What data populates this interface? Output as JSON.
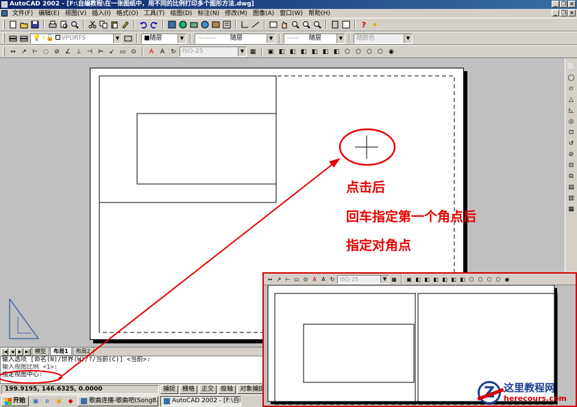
{
  "window": {
    "title": "AutoCAD 2002 - [F:\\自编教程\\在一张图纸中，用不同的比例打印多个图形方法.dwg]",
    "controls": [
      "_",
      "❐",
      "×"
    ]
  },
  "menu": {
    "items": [
      "文件(F)",
      "编辑(E)",
      "视图(V)",
      "插入(I)",
      "格式(O)",
      "工具(T)",
      "绘图(D)",
      "标注(N)",
      "修改(M)",
      "图像(A)",
      "窗口(W)",
      "帮助(H)"
    ],
    "doc_controls": [
      "_",
      "❐",
      "×"
    ]
  },
  "layer_toolbar": {
    "layer_name": "VPORTS",
    "color": "■随层",
    "linetype": "随层",
    "lineweight": "随层",
    "plot_style": "随颜色"
  },
  "dim_toolbar": {
    "dim_style": "ISO-25"
  },
  "drawing_tabs": {
    "tabs": [
      "模型",
      "布局1",
      "布局2"
    ],
    "active_index": 1
  },
  "command_window": {
    "lines": [
      "输入选项 [命名(N)/世界(W)/?/当前(C)] <当前>:",
      "输入视图比例 <1>:",
      "指定视图中心:"
    ]
  },
  "status_bar": {
    "coordinates": "199.9195, 146.6325, 0.0000",
    "toggles": [
      "捕捉",
      "栅格",
      "正交",
      "极轴",
      "对象捕捉"
    ]
  },
  "taskbar": {
    "start_label": "开始",
    "tasks": [
      "歌曲连播-歌曲吧(Song8…",
      "AutoCAD 2002 - [F:\\自编…"
    ],
    "active_index": 1
  },
  "annotations": {
    "lines": [
      "点击后",
      "回车指定第一个角点后",
      "指定对角点"
    ],
    "color": "#e60000"
  },
  "inset": {
    "dim_style": "ISO-25"
  },
  "watermark": {
    "title": "这里教程网",
    "url": "herecours.com"
  }
}
